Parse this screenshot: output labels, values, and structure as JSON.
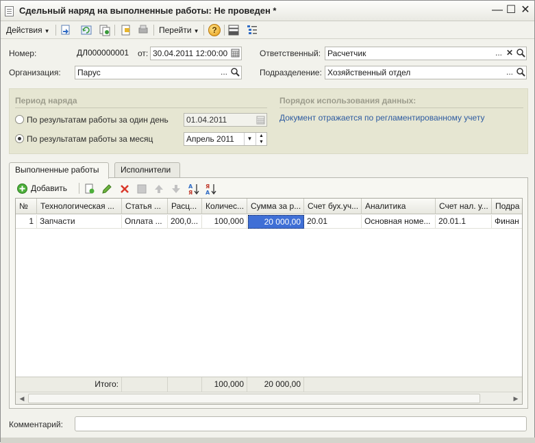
{
  "window": {
    "title": "Сдельный наряд на выполненные работы: Не проведен *",
    "minimize": "—",
    "maximize": "☐",
    "close": "✕"
  },
  "toolbar": {
    "actions_label": "Действия",
    "goto_label": "Перейти",
    "help_label": "?"
  },
  "form": {
    "number_label": "Номер:",
    "number_value": "ДЛ000000001",
    "from_label": "от:",
    "date_value": "30.04.2011 12:00:00",
    "responsible_label": "Ответственный:",
    "responsible_value": "Расчетчик",
    "org_label": "Организация:",
    "org_value": "Парус",
    "dept_label": "Подразделение:",
    "dept_value": "Хозяйственный отдел",
    "ellipsis": "...",
    "clear": "✕"
  },
  "period": {
    "title": "Период наряда",
    "option_day_label": "По результатам работы за один день",
    "day_value": "01.04.2011",
    "option_month_label": "По результатам работы за месяц",
    "month_value": "Апрель 2011",
    "usage_title": "Порядок использования данных:",
    "usage_link": "Документ отражается по регламентированному учету"
  },
  "tabs": {
    "works_label": "Выполненные работы",
    "performers_label": "Исполнители"
  },
  "grid_toolbar": {
    "add_label": "Добавить"
  },
  "table": {
    "columns": [
      "№",
      "Технологическая ...",
      "Статья ...",
      "Расц...",
      "Количес...",
      "Сумма за р...",
      "Счет бух.уч...",
      "Аналитика",
      "Счет нал. у...",
      "Подра"
    ],
    "rows": [
      [
        "1",
        "Запчасти",
        "Оплата ...",
        "200,0...",
        "100,000",
        "20 000,00",
        "20.01",
        "Основная номе...",
        "20.01.1",
        "Финан"
      ]
    ],
    "footer": {
      "total_label": "Итого:",
      "total_qty": "100,000",
      "total_sum": "20 000,00"
    }
  },
  "comment": {
    "label": "Комментарий:",
    "value": ""
  },
  "colors": {
    "selection": "#3f6fd6",
    "group_bg": "#e6e6d2",
    "link": "#2c5aa0"
  }
}
